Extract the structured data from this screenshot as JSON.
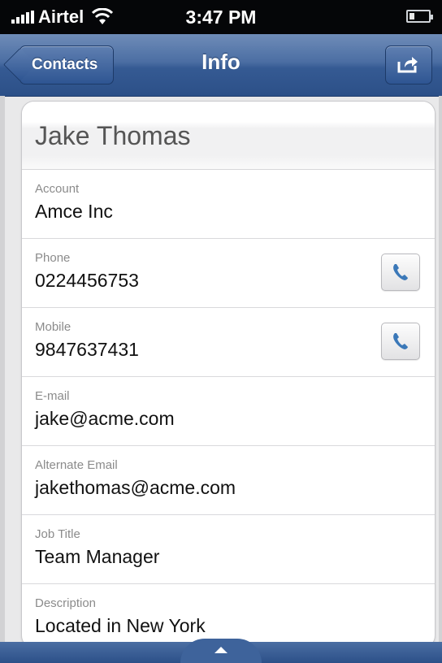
{
  "status": {
    "carrier": "Airtel",
    "time": "3:47 PM"
  },
  "nav": {
    "back_label": "Contacts",
    "title": "Info"
  },
  "contact": {
    "name": "Jake Thomas",
    "fields": [
      {
        "label": "Account",
        "value": "Amce Inc"
      },
      {
        "label": "Phone",
        "value": "0224456753"
      },
      {
        "label": "Mobile",
        "value": "9847637431"
      },
      {
        "label": "E-mail",
        "value": "jake@acme.com"
      },
      {
        "label": "Alternate Email",
        "value": "jakethomas@acme.com"
      },
      {
        "label": "Job Title",
        "value": "Team Manager"
      },
      {
        "label": "Description",
        "value": "Located in New York"
      }
    ]
  },
  "icons": {
    "signal": "signal-bars-icon",
    "wifi": "wifi-icon",
    "battery": "battery-icon",
    "share": "share-icon",
    "call": "phone-handset-icon",
    "expand": "chevron-up-icon"
  },
  "colors": {
    "nav": "#355a93",
    "status_bar": "#050608",
    "card_bg": "#ffffff",
    "page_bg": "#e9e9ea"
  }
}
